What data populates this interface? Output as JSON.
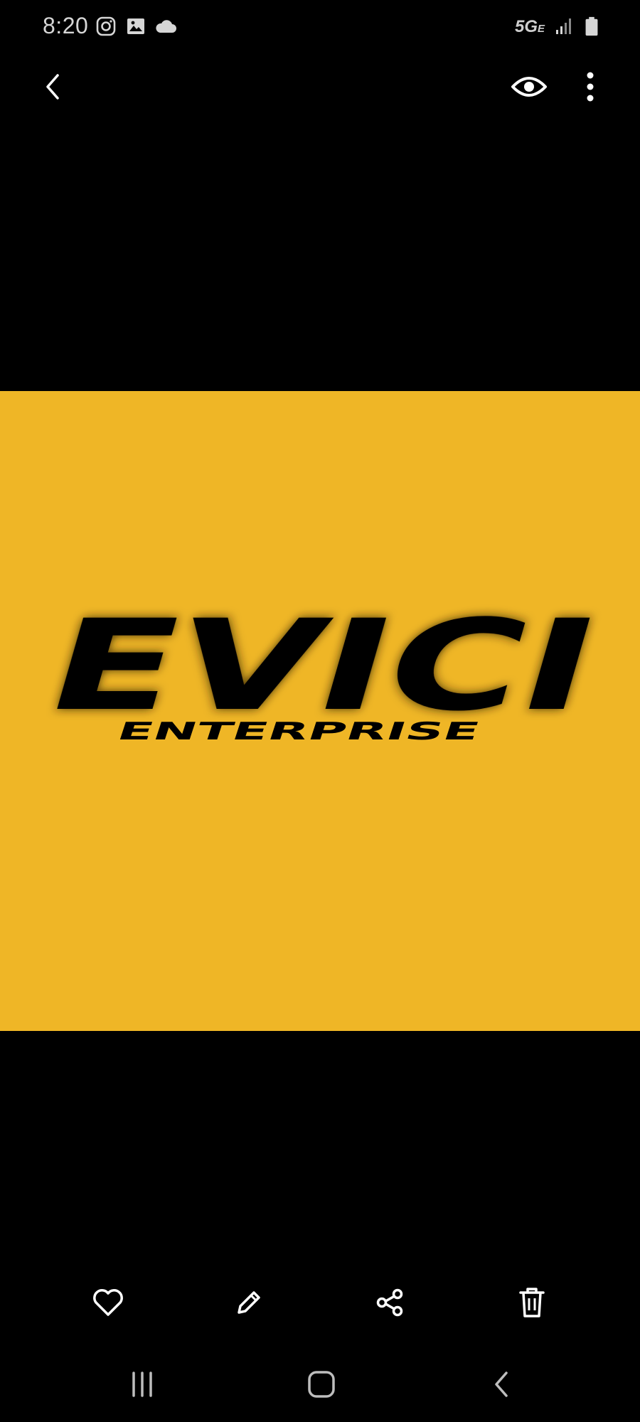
{
  "status_bar": {
    "time": "8:20",
    "network": "5G",
    "network_sub": "E",
    "icons": [
      "instagram-icon",
      "gallery-icon",
      "cloud-icon",
      "signal-icon",
      "battery-icon"
    ]
  },
  "top_bar": {
    "icons": [
      "back-arrow-icon",
      "eye-icon",
      "more-vertical-icon"
    ]
  },
  "photo": {
    "background_color": "#efb626",
    "logo_title": "EVICI",
    "logo_subtitle": "ENTERPRISE"
  },
  "bottom_toolbar": {
    "icons": [
      "heart-icon",
      "pencil-icon",
      "share-icon",
      "trash-icon"
    ]
  },
  "nav_bar": {
    "icons": [
      "recents-icon",
      "home-icon",
      "back-icon"
    ]
  }
}
